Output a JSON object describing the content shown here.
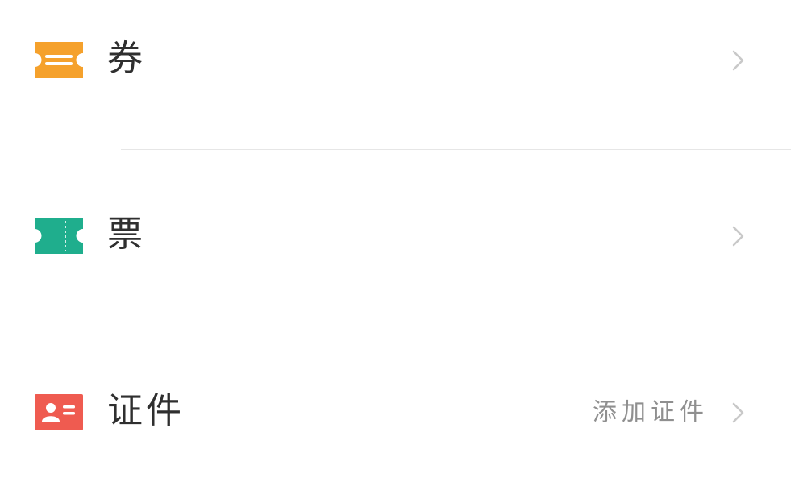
{
  "list": {
    "items": [
      {
        "label": "券",
        "icon": "coupon-icon",
        "icon_color": "#F5A12C",
        "detail": ""
      },
      {
        "label": "票",
        "icon": "ticket-icon",
        "icon_color": "#1FAE8D",
        "detail": ""
      },
      {
        "label": "证件",
        "icon": "id-card-icon",
        "icon_color": "#EF5B50",
        "detail": "添加证件"
      }
    ]
  },
  "colors": {
    "divider": "#E6E6E6",
    "chevron": "#C8C8C8",
    "label_text": "#2F2F2F",
    "detail_text": "#8F8F8F"
  }
}
